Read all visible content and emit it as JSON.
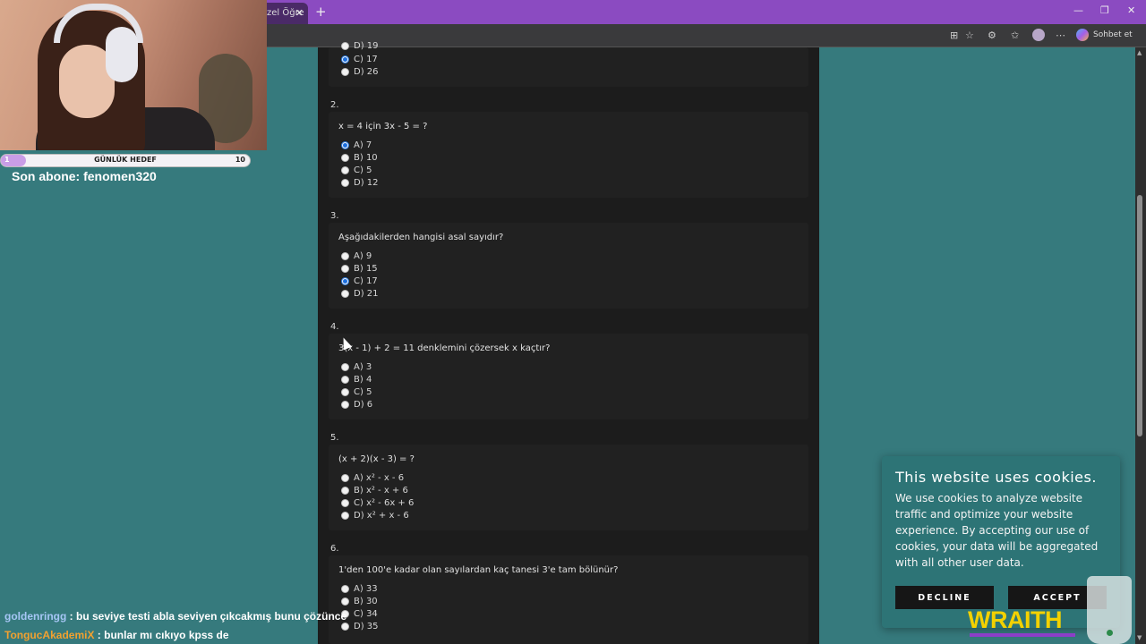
{
  "browser": {
    "tab_title": "zel Öğre",
    "tab_close": "✕",
    "new_tab": "+",
    "copilot_label": "Sohbet et",
    "window_controls": [
      "—",
      "❐",
      "✕"
    ]
  },
  "quiz": {
    "top_partial": {
      "options": [
        {
          "label": "D) 19",
          "selected": false
        },
        {
          "label": "C) 17",
          "selected": true
        },
        {
          "label": "D) 26",
          "selected": false
        }
      ]
    },
    "questions": [
      {
        "number": "2.",
        "text": "x = 4 için 3x - 5 = ?",
        "options": [
          {
            "label": "A) 7",
            "selected": true
          },
          {
            "label": "B) 10",
            "selected": false
          },
          {
            "label": "C) 5",
            "selected": false
          },
          {
            "label": "D) 12",
            "selected": false
          }
        ]
      },
      {
        "number": "3.",
        "text": "Aşağıdakilerden hangisi asal sayıdır?",
        "options": [
          {
            "label": "A) 9",
            "selected": false
          },
          {
            "label": "B) 15",
            "selected": false
          },
          {
            "label": "C) 17",
            "selected": true
          },
          {
            "label": "D) 21",
            "selected": false
          }
        ]
      },
      {
        "number": "4.",
        "text": "3(x - 1) + 2 = 11 denklemini çözersek x kaçtır?",
        "options": [
          {
            "label": "A) 3",
            "selected": false
          },
          {
            "label": "B) 4",
            "selected": false
          },
          {
            "label": "C) 5",
            "selected": false
          },
          {
            "label": "D) 6",
            "selected": false
          }
        ]
      },
      {
        "number": "5.",
        "text": "(x + 2)(x - 3) = ?",
        "options": [
          {
            "label": "A) x² - x - 6",
            "selected": false
          },
          {
            "label": "B) x² - x + 6",
            "selected": false
          },
          {
            "label": "C) x² - 6x + 6",
            "selected": false
          },
          {
            "label": "D) x² + x - 6",
            "selected": false
          }
        ]
      },
      {
        "number": "6.",
        "text": "1'den 100'e kadar olan sayılardan kaç tanesi 3'e tam bölünür?",
        "options": [
          {
            "label": "A) 33",
            "selected": false
          },
          {
            "label": "B) 30",
            "selected": false
          },
          {
            "label": "C) 34",
            "selected": false
          },
          {
            "label": "D) 35",
            "selected": false
          }
        ]
      }
    ]
  },
  "cookie_banner": {
    "title": "This website uses cookies.",
    "body": "We use cookies to analyze website traffic and optimize your website experience. By accepting our use of cookies, your data will be aggregated with all other user data.",
    "decline_label": "DECLINE",
    "accept_label": "ACCEPT"
  },
  "stream_overlay": {
    "goal": {
      "label": "GÜNLÜK HEDEF",
      "current": "1",
      "target": "10",
      "progress": 0.1
    },
    "last_sub": "Son abone: fenomen320",
    "chat": [
      {
        "user": "goldenringg",
        "message": " : bu seviye testi abla seviyen çıkcakmış bunu çözünce"
      },
      {
        "user": "TongucAkademiX",
        "message": " : bunlar mı cıkıyo kpss de"
      }
    ],
    "sponsor": "WRAITH"
  }
}
